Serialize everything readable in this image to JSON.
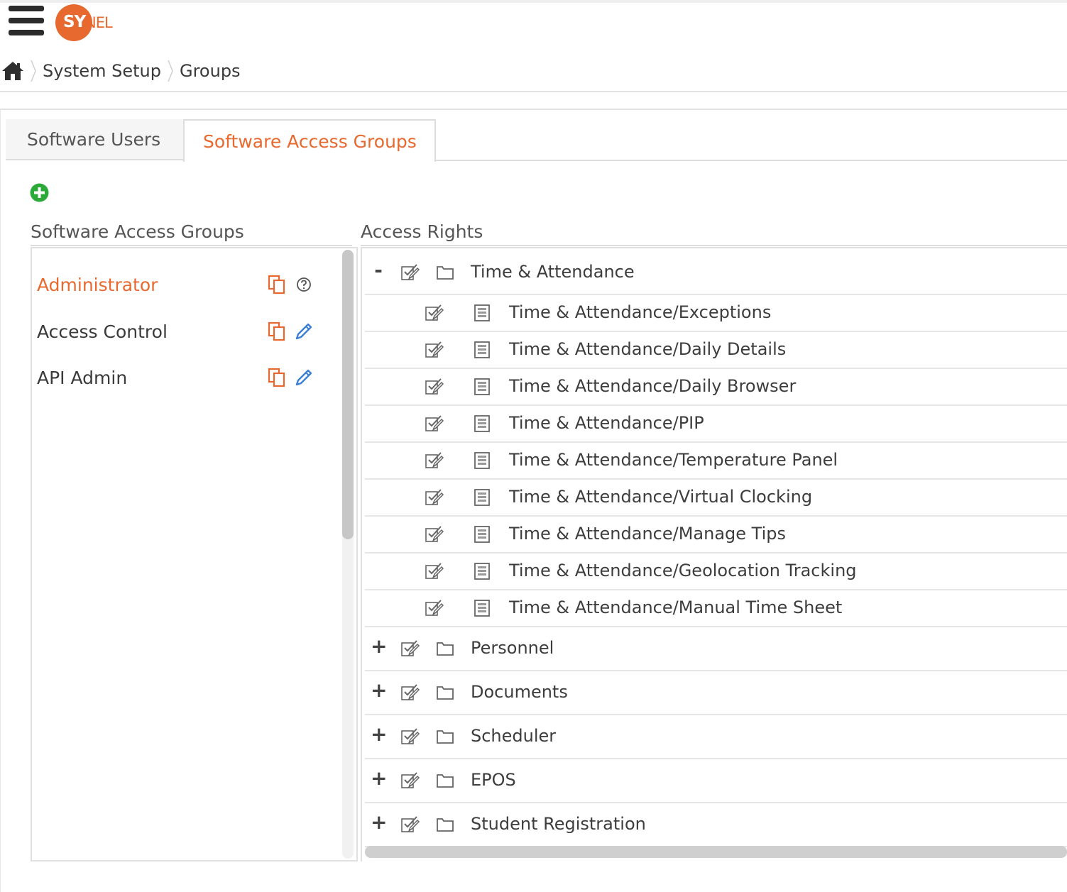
{
  "colors": {
    "accent": "#E8692F",
    "link_blue": "#3D7FD6",
    "add_green": "#2BAA3A"
  },
  "header": {
    "logo": {
      "left": "SY",
      "right": "NEL"
    },
    "menu_icon": "hamburger-icon"
  },
  "breadcrumb": {
    "home_icon": "home-icon",
    "items": [
      "System Setup",
      "Groups"
    ]
  },
  "tabs": [
    {
      "label": "Software Users",
      "active": false
    },
    {
      "label": "Software Access Groups",
      "active": true
    }
  ],
  "add_button_icon": "add-circle-icon",
  "groups_panel": {
    "title": "Software Access Groups",
    "items": [
      {
        "name": "Administrator",
        "selected": true,
        "copy_icon": "copy-icon",
        "action_icon": "help-icon"
      },
      {
        "name": "Access Control",
        "selected": false,
        "copy_icon": "copy-icon",
        "action_icon": "edit-pencil-icon"
      },
      {
        "name": "API Admin",
        "selected": false,
        "copy_icon": "copy-icon",
        "action_icon": "edit-pencil-icon"
      }
    ]
  },
  "rights_panel": {
    "title": "Access Rights",
    "tree": [
      {
        "label": "Time & Attendance",
        "toggle": "-",
        "expanded": true,
        "children": [
          "Time & Attendance/Exceptions",
          "Time & Attendance/Daily Details",
          "Time & Attendance/Daily Browser",
          "Time & Attendance/PIP",
          "Time & Attendance/Temperature Panel",
          "Time & Attendance/Virtual Clocking",
          "Time & Attendance/Manage Tips",
          "Time & Attendance/Geolocation Tracking",
          "Time & Attendance/Manual Time Sheet"
        ]
      },
      {
        "label": "Personnel",
        "toggle": "+",
        "expanded": false,
        "children": []
      },
      {
        "label": "Documents",
        "toggle": "+",
        "expanded": false,
        "children": []
      },
      {
        "label": "Scheduler",
        "toggle": "+",
        "expanded": false,
        "children": []
      },
      {
        "label": "EPOS",
        "toggle": "+",
        "expanded": false,
        "children": []
      },
      {
        "label": "Student Registration",
        "toggle": "+",
        "expanded": false,
        "children": []
      }
    ]
  }
}
